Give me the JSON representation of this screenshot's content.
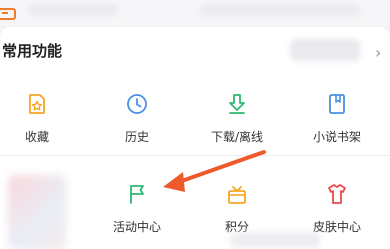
{
  "header": {
    "corner_icon": "back-box-icon"
  },
  "section": {
    "title": "常用功能",
    "chevron": "›"
  },
  "row1": [
    {
      "label": "收藏",
      "icon": "favorite-icon",
      "color": "#f5a623"
    },
    {
      "label": "历史",
      "icon": "clock-icon",
      "color": "#4a90e2"
    },
    {
      "label": "下载/离线",
      "icon": "download-icon",
      "color": "#2eb872"
    },
    {
      "label": "小说书架",
      "icon": "book-icon",
      "color": "#4a90e2"
    }
  ],
  "row2": [
    {
      "label": "活动中心",
      "icon": "flag-icon",
      "color": "#2eb872"
    },
    {
      "label": "积分",
      "icon": "gift-icon",
      "color": "#f5a623"
    },
    {
      "label": "皮肤中心",
      "icon": "tshirt-icon",
      "color": "#e94b4b"
    }
  ],
  "annotation": {
    "arrow_color": "#ee5a2a"
  }
}
